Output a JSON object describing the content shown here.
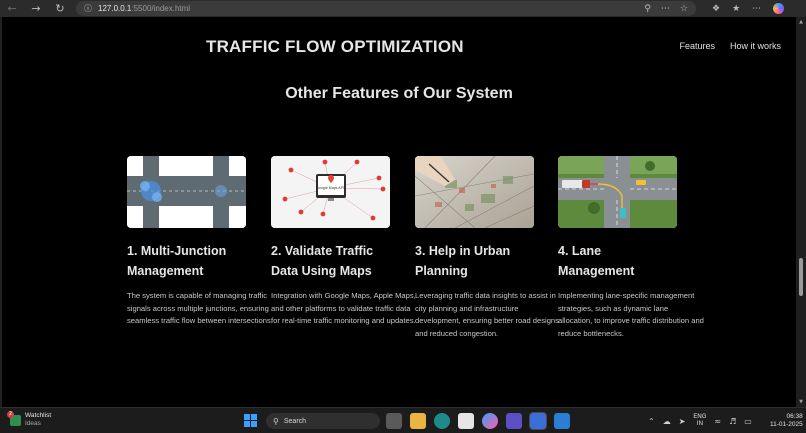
{
  "browser": {
    "url_host": "127.0.0.1",
    "url_path": ":5500/index.html",
    "back_icon": "back-arrow-icon",
    "forward_icon": "forward-arrow-icon",
    "refresh_icon": "refresh-icon"
  },
  "site": {
    "title": "TRAFFIC FLOW OPTIMIZATION",
    "nav": [
      "Features",
      "How it works"
    ]
  },
  "section": {
    "title": "Other Features of Our System"
  },
  "cards": [
    {
      "title_line1": "1. Multi-Junction",
      "title_line2": "Management",
      "description": "The system is capable of managing traffic signals across multiple junctions, ensuring seamless traffic flow between intersections.",
      "image": "junction-diagram"
    },
    {
      "title_line1": "2. Validate Traffic",
      "title_line2": "Data Using Maps",
      "description": "Integration with Google Maps, Apple Maps, and other platforms to validate traffic data for real-time traffic monitoring and updates.",
      "image": "google-maps-api",
      "image_text": "Google Maps APIs"
    },
    {
      "title_line1": "3. Help in Urban",
      "title_line2": "Planning",
      "description": "Leveraging traffic data insights to assist in city planning and infrastructure development, ensuring better road designs and reduced congestion.",
      "image": "urban-plan-photo"
    },
    {
      "title_line1": "4. Lane",
      "title_line2": "Management",
      "description": "Implementing lane-specific management strategies, such as dynamic lane allocation, to improve traffic distribution and reduce bottlenecks.",
      "image": "lane-intersection"
    }
  ],
  "taskbar": {
    "watchlist_title": "Watchlist",
    "watchlist_sub": "Ideas",
    "watchlist_badge": "2",
    "search_label": "Search",
    "lang_line1": "ENG",
    "lang_line2": "IN",
    "time": "06:38",
    "date": "11-01-2025"
  },
  "colors": {
    "page_bg": "#000000",
    "text": "#e6e6e6",
    "muted_text": "#c8c8c8",
    "map_pin": "#e53935"
  }
}
